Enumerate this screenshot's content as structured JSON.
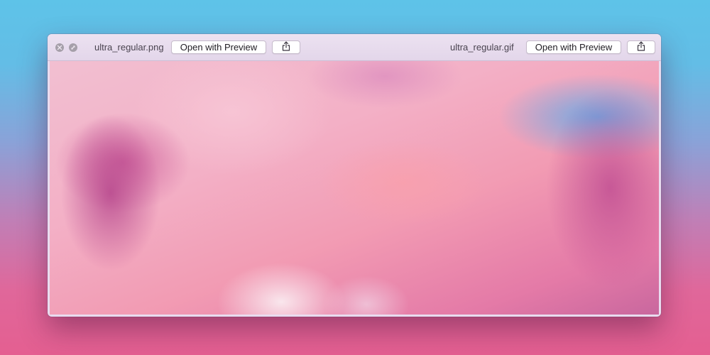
{
  "window": {
    "left_pane": {
      "filename": "ultra_regular.png",
      "open_button_label": "Open with Preview",
      "share_icon": "share-icon"
    },
    "right_pane": {
      "filename": "ultra_regular.gif",
      "open_button_label": "Open with Preview",
      "share_icon": "share-icon"
    },
    "controls": {
      "close_icon": "close-icon",
      "fullscreen_icon": "fullscreen-icon"
    },
    "preview_image": "pink-clouds-photo"
  },
  "colors": {
    "titlebar": "#e6daec",
    "button_bg": "#ffffff",
    "control_gray": "#a59fa9",
    "desktop_top": "#5ec3e8",
    "desktop_bottom": "#e45f91"
  }
}
